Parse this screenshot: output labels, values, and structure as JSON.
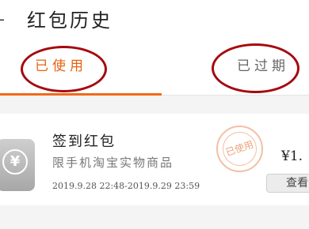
{
  "header": {
    "back_icon": "back-arrow-icon",
    "back_glyph": "–",
    "title": "红包历史"
  },
  "tabs": [
    {
      "label": "已使用",
      "active": true
    },
    {
      "label": "已过期",
      "active": false
    }
  ],
  "annotations": {
    "ring_color": "#a6080e"
  },
  "coupon": {
    "icon": "yen-coupon-icon",
    "icon_glyph": "¥",
    "name": "签到红包",
    "scope": "限手机淘宝实物商品",
    "period": "2019.9.28 22:48-2019.9.29 23:59",
    "stamp_text": "已使用",
    "amount": "¥1.",
    "action_label": "查看"
  },
  "colors": {
    "accent": "#f06a1a",
    "active_tab_text": "#e8620f",
    "stamp": "#eea27a"
  }
}
